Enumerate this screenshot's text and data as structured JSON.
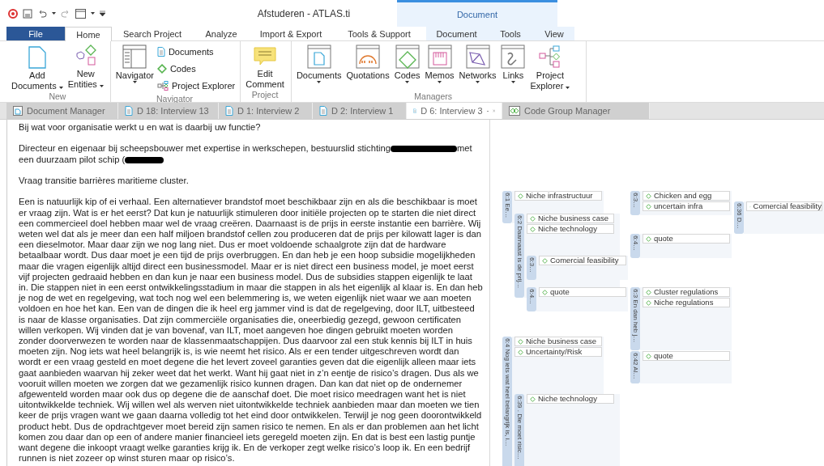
{
  "title_bar": {
    "title": "Afstuderen - ATLAS.ti",
    "contextual_header": "Document"
  },
  "ribbon_tabs": [
    {
      "label": "File",
      "kind": "file",
      "selected": false
    },
    {
      "label": "Home",
      "kind": "main",
      "selected": true
    },
    {
      "label": "Search Project",
      "kind": "main",
      "selected": false
    },
    {
      "label": "Analyze",
      "kind": "main",
      "selected": false
    },
    {
      "label": "Import & Export",
      "kind": "main",
      "selected": false
    },
    {
      "label": "Tools & Support",
      "kind": "main",
      "selected": false
    },
    {
      "label": "Document",
      "kind": "contextual",
      "selected": false
    },
    {
      "label": "Tools",
      "kind": "contextual",
      "selected": false
    },
    {
      "label": "View",
      "kind": "contextual",
      "selected": false
    }
  ],
  "ribbon_groups": [
    {
      "label": "New",
      "large_buttons": [
        {
          "kind": "add-document",
          "dropdown": true,
          "lines": [
            "Add",
            "Documents"
          ]
        },
        {
          "kind": "new-entities",
          "dropdown": true,
          "lines": [
            "New",
            "Entities"
          ]
        }
      ]
    },
    {
      "label": "Navigator",
      "large_buttons": [
        {
          "kind": "navigator",
          "dropdown": true,
          "lines": [
            "Navigator"
          ]
        }
      ],
      "small_buttons": [
        {
          "kind": "document",
          "label": "Documents"
        },
        {
          "kind": "code",
          "label": "Codes"
        },
        {
          "kind": "explorer",
          "label": "Project Explorer"
        }
      ]
    },
    {
      "label": "Project",
      "large_buttons": [
        {
          "kind": "comment",
          "dropdown": false,
          "lines": [
            "Edit",
            "Comment"
          ]
        }
      ]
    },
    {
      "label": "Managers",
      "large_buttons": [
        {
          "kind": "documents-manager",
          "dropdown": true,
          "lines": [
            "Documents"
          ]
        },
        {
          "kind": "quotations",
          "dropdown": false,
          "lines": [
            "Quotations"
          ]
        },
        {
          "kind": "codes-manager",
          "dropdown": true,
          "lines": [
            "Codes"
          ]
        },
        {
          "kind": "memos",
          "dropdown": true,
          "lines": [
            "Memos"
          ]
        },
        {
          "kind": "networks",
          "dropdown": true,
          "lines": [
            "Networks"
          ]
        },
        {
          "kind": "links",
          "dropdown": true,
          "lines": [
            "Links"
          ]
        },
        {
          "kind": "explorer-large",
          "dropdown": true,
          "lines": [
            "Project",
            "Explorer"
          ]
        }
      ]
    }
  ],
  "document_tabs": [
    {
      "label": "Document Manager",
      "kind": "manager",
      "selected": false
    },
    {
      "label": "D 18: Interview 13",
      "kind": "document",
      "selected": false
    },
    {
      "label": "D 1: Interview 2",
      "kind": "document",
      "selected": false
    },
    {
      "label": "D 2: Interview 1",
      "kind": "document",
      "selected": false
    },
    {
      "label": "D 6: Interview 3",
      "kind": "document",
      "selected": true
    },
    {
      "label": "Code Group Manager",
      "kind": "code-group",
      "selected": false
    }
  ],
  "document": {
    "paragraphs": [
      {
        "parts": [
          {
            "kind": "text",
            "text": "Bij wat voor organisatie werkt u en wat is daarbij uw functie?"
          }
        ]
      },
      {
        "parts": [
          {
            "kind": "text",
            "text": "Directeur en eigenaar bij scheepsbouwer met expertise in werkschepen, bestuurslid stichting"
          },
          {
            "kind": "redaction"
          },
          {
            "kind": "text",
            "text": "met"
          },
          {
            "kind": "text",
            "text": "een duurzaam pilot schip ("
          },
          {
            "kind": "redaction"
          }
        ]
      },
      {
        "parts": [
          {
            "kind": "text",
            "text": "Vraag transitie barrières maritieme cluster."
          }
        ]
      },
      {
        "parts": [
          {
            "kind": "text",
            "text": "Een is natuurlijk kip of ei verhaal. Een alternatiever brandstof moet beschikbaar zijn en als die beschikbaar is moet er vraag zijn. Wat is er het eerst? Dat kun je natuurlijk stimuleren door initiële projecten op te starten die niet direct een commercieel doel hebben maar wel de vraag creëren. Daarnaast is de prijs in eerste instantie een barrière. Wij weten wel dat als je meer dan een half miljoen brandstof cellen zou produceren dat de prijs per kilowatt lager is dan een dieselmotor. Maar daar zijn we nog lang niet. Dus er moet voldoende schaalgrote zijn dat de hardware betaalbaar wordt. Dus daar moet je een tijd de prijs overbruggen. En dan heb je een hoop subsidie mogelijkheden maar die vragen eigenlijk altijd direct een businessmodel. Maar er is niet direct een business model, je moet eerst vijf projecten gedraaid hebben en dan kun je naar een business model. Dus de subsidies stappen eigenlijk te laat in. Die stappen niet in een eerst ontwikkelingsstadium in maar die stappen in als het eigenlijk al klaar is. En dan heb je nog de wet en regelgeving, wat toch nog wel een belemmering is, we weten eigenlijk niet waar we aan moeten voldoen en hoe het kan. Een van de dingen die ik heel erg jammer vind is dat de regelgeving, door ILT, uitbesteed is naar de klasse organisaties. Dat zijn commerciële organisaties die, oneerbiedig gezegd, gewoon certificaten willen verkopen. Wij vinden dat je van bovenaf, van ILT, moet aangeven hoe dingen gebruikt moeten worden zonder doorverwezen te worden naar de klassenmaatschappijen. Dus daarvoor zal een stuk kennis bij ILT in huis moeten zijn. Nog iets wat heel belangrijk is, is wie neemt het risico. Als er een tender uitgeschreven wordt dan wordt er een vraag gesteld en moet degene die het levert zoveel garanties geven dat die eigenlijk alleen maar iets gaat aanbieden waarvan hij zeker weet dat het werkt. Want hij gaat niet in z’n eentje de risico’s dragen. Dus als we vooruit willen moeten we zorgen dat we gezamenlijk risico kunnen dragen. Dan kan dat niet op de ondernemer afgewenteld worden maar ook dus op degene die de aanschaf doet. Die moet risico meedragen want het is niet uitontwikkelde techniek. Wij willen wel als werven niet uitontwikkelde techniek aanbieden maar dan moeten we tien keer de prijs vragen want we gaan daarna volledig tot het eind door ontwikkelen. Terwijl je nog geen doorontwikkeld product hebt. Dus de opdrachtgever moet bereid zijn samen risico te nemen. En als er dan problemen aan het licht komen zou daar dan op een of andere manier financieel iets geregeld moeten zijn. En dat is best een lastig puntje want degene die inkoopt vraagt welke garanties krijg ik. En de verkoper zegt welke risico’s loop ik. En een bedrijf runnen is niet zozeer op winst sturen maar op risico’s."
          }
        ]
      }
    ]
  },
  "margin": {
    "quotations": [
      {
        "label": "6:1 Ee…",
        "codes": [
          "Niche infrastructuur"
        ]
      },
      {
        "label": "6:2 Daarnaast is de prij…",
        "codes": [
          "Niche business case",
          "Niche technology"
        ]
      },
      {
        "label": "6:3…",
        "codes": [
          "Comercial feasibility"
        ]
      },
      {
        "label": "6:4…",
        "codes": [
          "quote"
        ]
      },
      {
        "label": "6:3…",
        "codes": [
          "Chicken and egg",
          "uncertain infra"
        ]
      },
      {
        "label": "6:36 D…",
        "codes": [
          "Comercial feasibility"
        ]
      },
      {
        "label": "6:4…",
        "codes": [
          "quote"
        ]
      },
      {
        "label": "6:3 En dan heb j…",
        "codes": [
          "Cluster regulations",
          "Niche regulations"
        ]
      },
      {
        "label": "6:42 Al…",
        "codes": [
          "quote"
        ]
      },
      {
        "label": "6:4 Nog iets wat heel belangrijk is, i…",
        "codes": [
          "Niche business case",
          "Uncertainty/Risk"
        ]
      },
      {
        "label": "6:39 . Die moet risic…",
        "codes": [
          "Niche technology"
        ]
      }
    ]
  }
}
